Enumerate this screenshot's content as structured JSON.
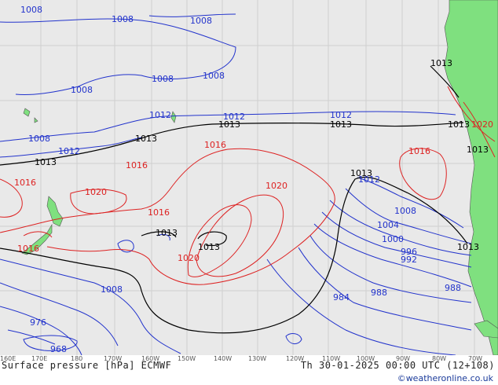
{
  "map": {
    "colors": {
      "ocean": "#e9e9e9",
      "land": "#7fe07f",
      "isobar_low": "#2233cc",
      "isobar_mid": "#000000",
      "isobar_high": "#dd2222",
      "grid": "#cccccc"
    },
    "longitude_labels": [
      "160E",
      "170E",
      "180",
      "170W",
      "160W",
      "150W",
      "140W",
      "130W",
      "120W",
      "110W",
      "100W",
      "90W",
      "80W",
      "70W"
    ],
    "isobar_labels": {
      "l1008a": "1008",
      "l1008b": "1008",
      "l1008c": "1008",
      "l1008d": "1008",
      "l1008e": "1008",
      "l1008f": "1008",
      "l1008g": "1008",
      "l1008h": "1008",
      "l1008i": "1008",
      "l1012a": "1012",
      "l1012b": "1012",
      "l1012c": "1012",
      "l1012d": "1012",
      "l1012e": "1012",
      "l1013a": "1013",
      "l1013b": "1013",
      "l1013c": "1013",
      "l1013d": "1013",
      "l1013e": "1013",
      "l1013f": "1013",
      "l1013g": "1013",
      "l1013h": "1013",
      "l1013i": "1013",
      "l1013j": "1013",
      "l1013k": "1013",
      "l1016a": "1016",
      "l1016b": "1016",
      "l1016c": "1016",
      "l1016d": "1016",
      "l1016e": "1016",
      "l1016f": "1016",
      "l1020a": "1020",
      "l1020b": "1020",
      "l1020c": "1020",
      "l1020d": "1020",
      "l1004": "1004",
      "l1000": "1000",
      "l996": "996",
      "l992": "992",
      "l988a": "988",
      "l988b": "988",
      "l984": "984",
      "l976": "976",
      "l968": "968"
    }
  },
  "footer": {
    "title_left": "Surface pressure [hPa] ECMWF",
    "title_right": "Th 30-01-2025 00:00 UTC (12+108)",
    "credit": "©weatheronline.co.uk"
  }
}
